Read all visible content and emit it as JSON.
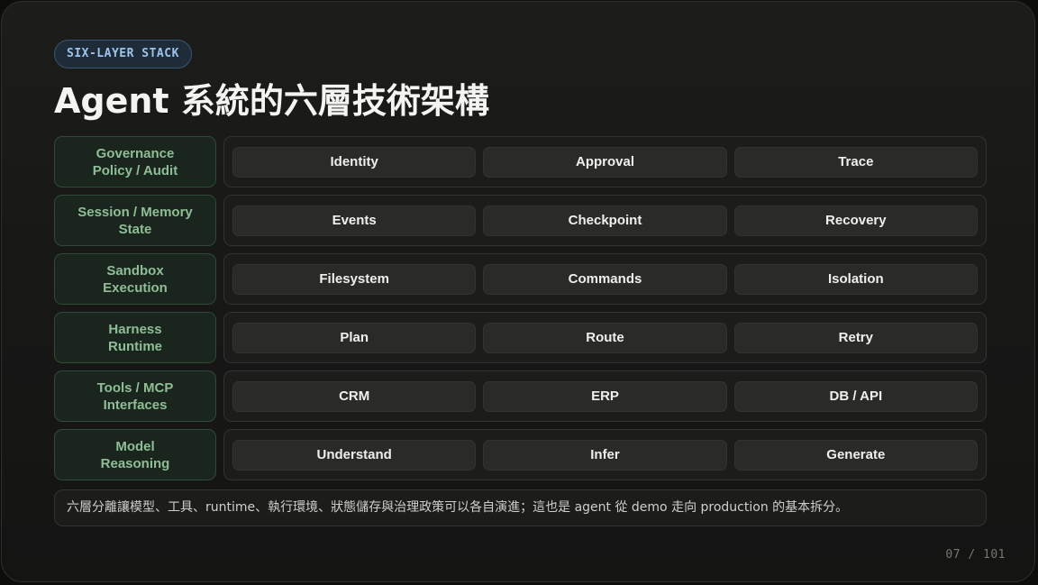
{
  "header": {
    "badge": "SIX-LAYER STACK",
    "title": "Agent 系統的六層技術架構"
  },
  "layers": [
    {
      "label_line1": "Governance",
      "label_line2": "Policy / Audit",
      "items": [
        "Identity",
        "Approval",
        "Trace"
      ]
    },
    {
      "label_line1": "Session / Memory",
      "label_line2": "State",
      "items": [
        "Events",
        "Checkpoint",
        "Recovery"
      ]
    },
    {
      "label_line1": "Sandbox",
      "label_line2": "Execution",
      "items": [
        "Filesystem",
        "Commands",
        "Isolation"
      ]
    },
    {
      "label_line1": "Harness",
      "label_line2": "Runtime",
      "items": [
        "Plan",
        "Route",
        "Retry"
      ]
    },
    {
      "label_line1": "Tools / MCP",
      "label_line2": "Interfaces",
      "items": [
        "CRM",
        "ERP",
        "DB / API"
      ]
    },
    {
      "label_line1": "Model",
      "label_line2": "Reasoning",
      "items": [
        "Understand",
        "Infer",
        "Generate"
      ]
    }
  ],
  "footnote": "六層分離讓模型、工具、runtime、執行環境、狀態儲存與治理政策可以各自演進；這也是 agent 從 demo 走向 production 的基本拆分。",
  "page": {
    "indicator": "07 / 101"
  },
  "colors": {
    "background": "#171716",
    "badge_text": "#9ec3ea",
    "layer_label_text": "#8fbe96",
    "pill_background": "#2a2a29"
  }
}
